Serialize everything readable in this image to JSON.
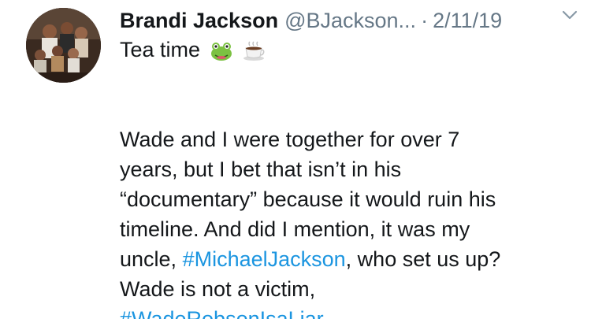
{
  "tweet": {
    "author_name": "Brandi Jackson",
    "handle": "@BJackson...",
    "separator": "·",
    "date": "2/11/19",
    "first_line": "Tea time",
    "emojis": [
      "frog-face-icon",
      "hot-beverage-icon"
    ],
    "lines": {
      "l1": "Wade and I were together for over 7",
      "l2": "years, but I bet that isn’t in his",
      "l3": "“documentary” because it would ruin his",
      "l4": "timeline.  And did I mention, it was my",
      "l5_pre": "uncle, ",
      "l5_tag": "#MichaelJackson",
      "l5_post": ", who set us up?",
      "l6": "Wade is not a victim,",
      "l7_tag": "#WadeRobsonIsaLiar"
    }
  },
  "colors": {
    "text": "#14171a",
    "secondary": "#657786",
    "link": "#1b95e0",
    "background": "#ffffff"
  },
  "icons": {
    "caret": "chevron-down-icon"
  }
}
